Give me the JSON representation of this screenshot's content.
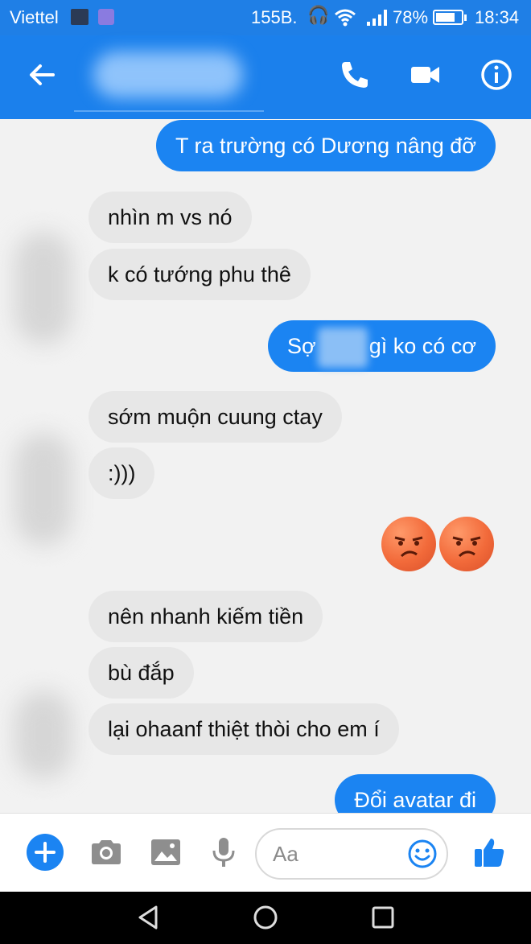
{
  "status_bar": {
    "carrier": "Viettel",
    "speed": "155B.",
    "battery_pct": "78%",
    "battery_level": 0.78,
    "time": "18:34"
  },
  "header": {
    "back_icon": "arrow-left-icon",
    "actions": [
      "phone-icon",
      "video-camera-icon",
      "info-icon"
    ]
  },
  "messages": [
    {
      "dir": "out",
      "text": "T ra trường có Dương nâng đỡ"
    },
    {
      "dir": "in",
      "text": "nhìn m vs nó"
    },
    {
      "dir": "in",
      "text": "k có tướng phu thê"
    },
    {
      "dir": "out",
      "text_before": "Sợ",
      "text_after": "gì ko có cơ"
    },
    {
      "dir": "in",
      "text": "sớm muộn cuung ctay"
    },
    {
      "dir": "in",
      "text": ":)))"
    },
    {
      "dir": "in",
      "text": "nên nhanh kiếm tiền"
    },
    {
      "dir": "in",
      "text": "bù đắp"
    },
    {
      "dir": "in",
      "text": "lại ohaanf thiệt thòi cho em í"
    },
    {
      "dir": "out",
      "text": "Đổi avatar đi"
    }
  ],
  "reaction_emojis": [
    "unamused-angry-face-icon",
    "unamused-angry-face-icon"
  ],
  "composer": {
    "placeholder": "Aa",
    "icons": [
      "plus-icon",
      "camera-icon",
      "image-icon",
      "microphone-icon",
      "smiley-icon",
      "thumbs-up-icon"
    ]
  },
  "colors": {
    "brand_blue": "#1b80ec",
    "outgoing_bubble": "#1b84f2",
    "incoming_bubble": "#e7e7e7"
  }
}
